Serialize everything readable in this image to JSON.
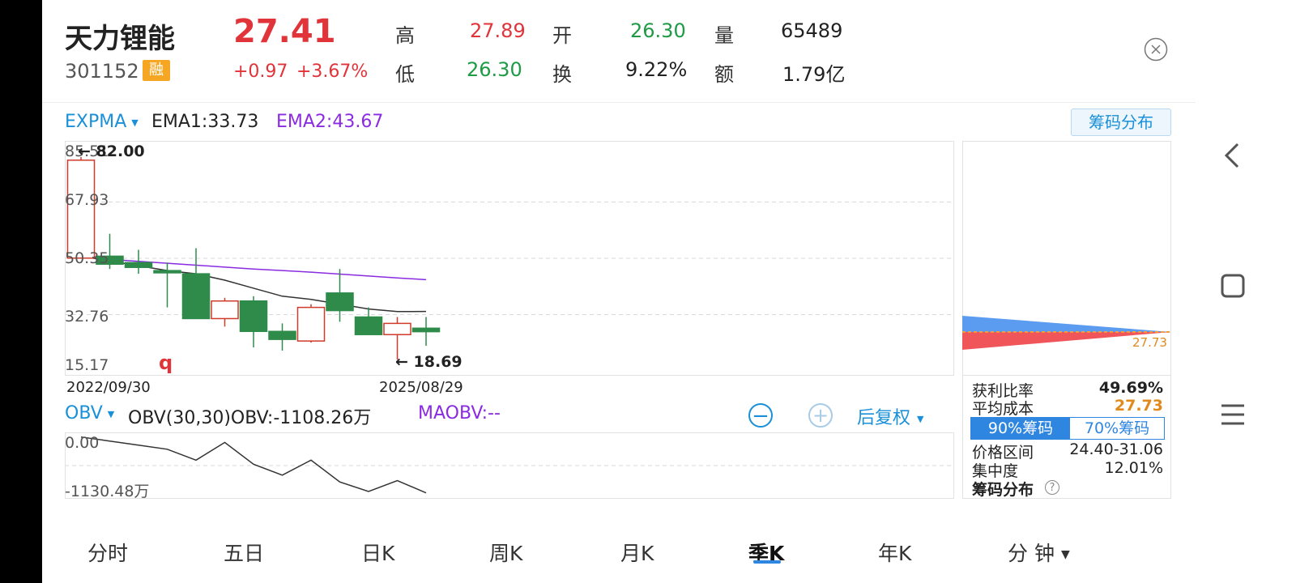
{
  "header": {
    "name": "天力锂能",
    "code": "301152",
    "margin_badge": "融",
    "price": "27.41",
    "change": "+0.97",
    "change_pct": "+3.67%",
    "high_label": "高",
    "high_value": "27.89",
    "low_label": "低",
    "low_value": "26.30",
    "open_label": "开",
    "open_value": "26.30",
    "turnover_label": "换",
    "turnover_value": "9.22%",
    "volume_label": "量",
    "volume_value": "65489",
    "amount_label": "额",
    "amount_value": "1.79亿"
  },
  "indicator": {
    "name": "EXPMA",
    "ema1": "EMA1:33.73",
    "ema2": "EMA2:43.67",
    "chips_button": "筹码分布"
  },
  "chart_data": {
    "type": "candlestick",
    "period": "季K",
    "x_start_label": "2022/09/30",
    "x_end_label": "2025/08/29",
    "y_ticks": [
      "85.51",
      "67.93",
      "50.35",
      "32.76",
      "15.17"
    ],
    "ylim": [
      15.17,
      85.51
    ],
    "max_marker": "82.00",
    "min_marker": "18.69",
    "q_marker": "q",
    "candles": [
      {
        "open": 50.4,
        "close": 81.0,
        "high": 82.0,
        "low": 50.4
      },
      {
        "open": 51.0,
        "close": 48.5,
        "high": 58.0,
        "low": 47.0
      },
      {
        "open": 49.0,
        "close": 47.5,
        "high": 53.0,
        "low": 45.5
      },
      {
        "open": 46.5,
        "close": 45.8,
        "high": 49.0,
        "low": 35.0
      },
      {
        "open": 45.5,
        "close": 31.5,
        "high": 53.5,
        "low": 31.5
      },
      {
        "open": 31.5,
        "close": 37.0,
        "high": 38.0,
        "low": 29.0
      },
      {
        "open": 37.0,
        "close": 27.5,
        "high": 38.5,
        "low": 22.5
      },
      {
        "open": 27.5,
        "close": 25.0,
        "high": 30.0,
        "low": 21.5
      },
      {
        "open": 24.5,
        "close": 35.0,
        "high": 36.0,
        "low": 24.0
      },
      {
        "open": 39.5,
        "close": 34.0,
        "high": 47.0,
        "low": 30.5
      },
      {
        "open": 32.0,
        "close": 26.5,
        "high": 35.0,
        "low": 26.5
      },
      {
        "open": 26.5,
        "close": 30.0,
        "high": 32.0,
        "low": 18.69
      },
      {
        "open": 28.5,
        "close": 27.41,
        "high": 32.0,
        "low": 23.0
      }
    ],
    "ema1": [
      51.0,
      49.5,
      48.0,
      46.5,
      45.5,
      43.5,
      41.0,
      38.5,
      37.5,
      36.0,
      34.5,
      33.7,
      33.73
    ],
    "ema2": [
      51.0,
      50.0,
      49.4,
      48.8,
      48.2,
      47.6,
      47.0,
      46.5,
      46.0,
      45.4,
      44.8,
      44.2,
      43.67
    ],
    "colors": {
      "up": "#d03a2a",
      "down": "#2e8b4a",
      "ema1": "#333333",
      "ema2": "#8a2be2"
    }
  },
  "obv": {
    "name": "OBV",
    "params": "OBV(30,30)OBV:-1108.26万",
    "ma": "MAOBV:--",
    "y_top": "0.00",
    "y_bottom": "-1130.48万",
    "values": [
      0,
      -30,
      -60,
      -90,
      -170,
      -40,
      -200,
      -280,
      -170,
      -330,
      -400,
      -320,
      -410
    ]
  },
  "controls": {
    "zoom_out": "−",
    "zoom_in": "+",
    "adjust": "后复权"
  },
  "chips": {
    "cost_marker": "27.73",
    "profit_label": "获利比率",
    "profit_value": "49.69%",
    "avg_cost_label": "平均成本",
    "avg_cost_value": "27.73",
    "tab_90": "90%筹码",
    "tab_70": "70%筹码",
    "range_label": "价格区间",
    "range_value": "24.40-31.06",
    "concentration_label": "集中度",
    "concentration_value": "12.01%",
    "footer": "筹码分布",
    "help": "?"
  },
  "tabs": [
    "分时",
    "五日",
    "日K",
    "周K",
    "月K",
    "季K",
    "年K",
    "分 钟"
  ],
  "active_tab": "季K",
  "nav": {
    "back": "<",
    "home": "□",
    "menu": "≡"
  }
}
